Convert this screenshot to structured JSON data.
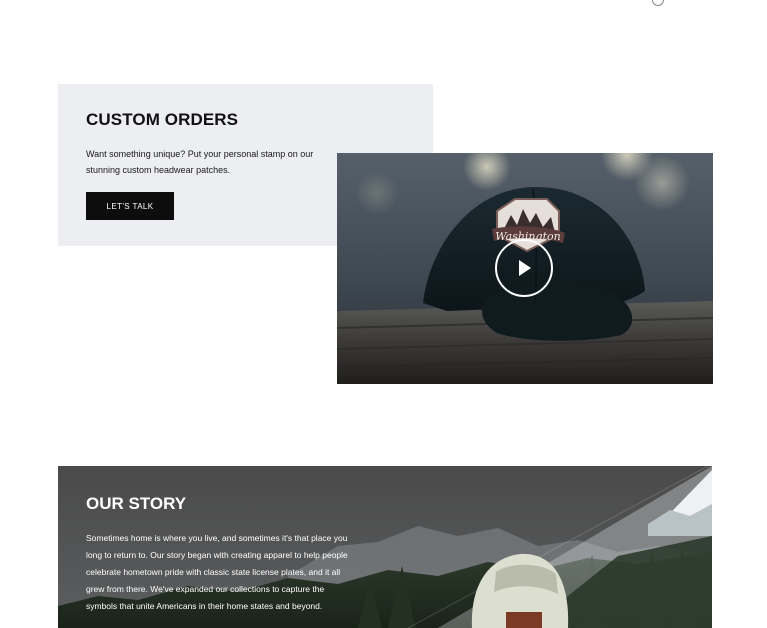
{
  "custom_orders": {
    "title": "CUSTOM ORDERS",
    "description": "Want something unique? Put your personal stamp on our stunning custom headwear patches.",
    "button_label": "LET'S TALK"
  },
  "video": {
    "patch_text": "Washington",
    "play_icon": "play-icon"
  },
  "our_story": {
    "title": "OUR STORY",
    "body": "Sometimes home is where you live, and sometimes it's that place you long to return to. Our story began with creating apparel to help people celebrate hometown pride with classic state license plates, and it all grew from there. We've expanded our collections to capture the symbols that unite Americans in their home states and beyond."
  },
  "colors": {
    "panel_bg": "#edeef2",
    "button_bg": "#0d0d0d",
    "text_dark": "#111111"
  }
}
